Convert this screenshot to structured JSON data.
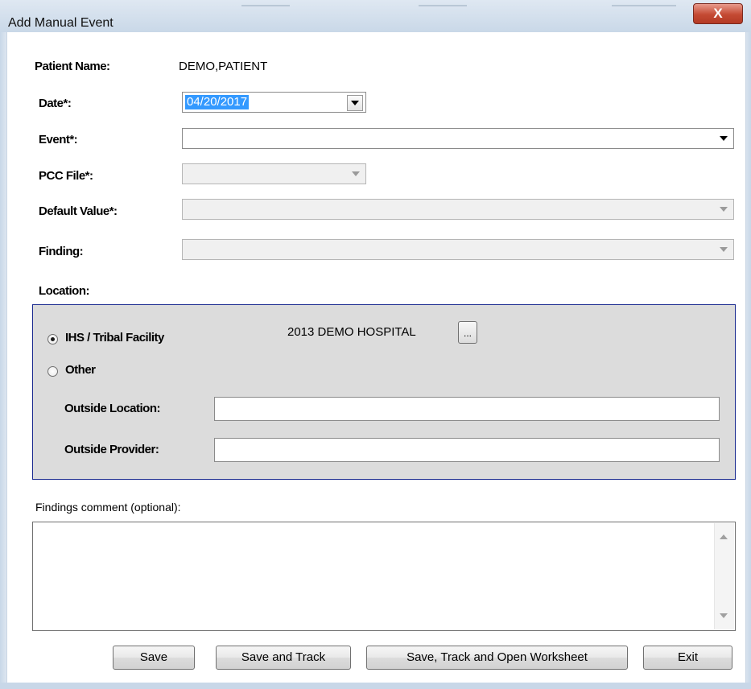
{
  "window": {
    "title": "Add Manual Event",
    "close_glyph": "X"
  },
  "form": {
    "patient_name_label": "Patient Name:",
    "patient_name_value": "DEMO,PATIENT",
    "date_label": "Date*:",
    "date_value": "04/20/2017",
    "event_label": "Event*:",
    "event_value": "",
    "pcc_file_label": "PCC File*:",
    "default_value_label": "Default Value*:",
    "finding_label": "Finding:",
    "location_label": "Location:"
  },
  "location": {
    "ihs_option": "IHS / Tribal Facility",
    "ihs_selected": true,
    "facility_name": "2013 DEMO HOSPITAL",
    "browse_label": "...",
    "other_option": "Other",
    "outside_location_label": "Outside Location:",
    "outside_location_value": "",
    "outside_provider_label": "Outside Provider:",
    "outside_provider_value": ""
  },
  "comment": {
    "label": "Findings comment (optional):",
    "value": ""
  },
  "buttons": {
    "save": "Save",
    "save_track": "Save and Track",
    "save_track_open": "Save, Track and Open Worksheet",
    "exit": "Exit"
  },
  "colors": {
    "selection": "#3399ff",
    "group_border": "#1a2a8f",
    "group_bg": "#dcdcdc",
    "close_red": "#c44a33"
  }
}
